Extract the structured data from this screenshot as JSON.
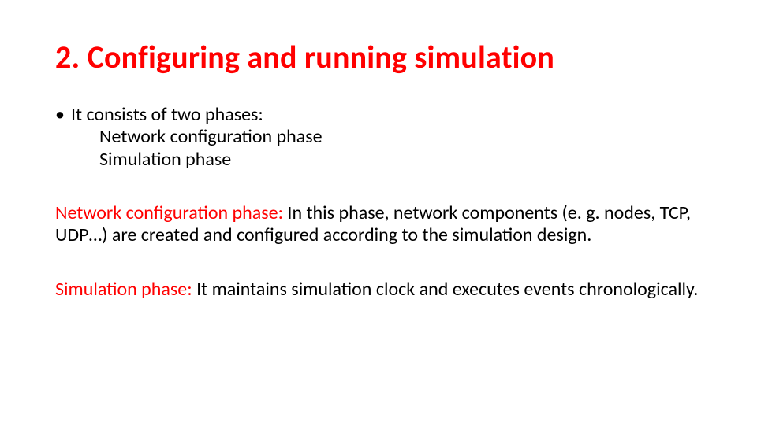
{
  "title": "2. Configuring and running simulation",
  "bullet_lead": "It consists of two phases:",
  "phase_list": {
    "item1": "Network configuration phase",
    "item2": "Simulation phase"
  },
  "para1": {
    "label": "Network configuration phase: ",
    "text": "In this phase, network components (e. g. nodes, TCP, UDP…) are created and configured according to the simulation design."
  },
  "para2": {
    "label": "Simulation phase: ",
    "text": "It maintains simulation clock and executes events chronologically."
  }
}
